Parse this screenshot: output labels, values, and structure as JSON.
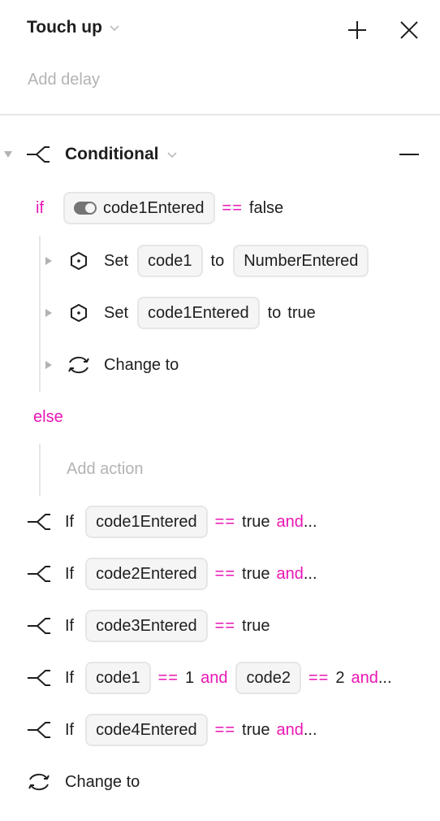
{
  "header": {
    "title": "Touch up",
    "add_delay": "Add delay"
  },
  "conditional": {
    "label": "Conditional",
    "if_keyword": "if",
    "else_keyword": "else",
    "condition": {
      "variable": "code1Entered",
      "operator": "==",
      "value": "false"
    },
    "if_actions": [
      {
        "verb": "Set",
        "target": "code1",
        "to": "to",
        "value": "NumberEntered"
      },
      {
        "verb": "Set",
        "target": "code1Entered",
        "to": "to",
        "value": "true"
      },
      {
        "label": "Change to"
      }
    ],
    "else_add_action": "Add action"
  },
  "conditions": [
    {
      "if": "If",
      "var": "code1Entered",
      "op": "==",
      "val": "true",
      "and": "and",
      "ellipsis": "..."
    },
    {
      "if": "If",
      "var": "code2Entered",
      "op": "==",
      "val": "true",
      "and": "and",
      "ellipsis": "..."
    },
    {
      "if": "If",
      "var": "code3Entered",
      "op": "==",
      "val": "true"
    },
    {
      "if": "If",
      "var": "code1",
      "op": "==",
      "val": "1",
      "and": "and",
      "var2": "code2",
      "op2": "==",
      "val2": "2",
      "and2": "and",
      "ellipsis": "..."
    },
    {
      "if": "If",
      "var": "code4Entered",
      "op": "==",
      "val": "true",
      "and": "and",
      "ellipsis": "..."
    }
  ],
  "final_action": {
    "label": "Change to"
  },
  "colors": {
    "keyword": "#e916b4",
    "muted": "#b3b3b3",
    "chip_bg": "#f5f5f5",
    "border": "#e6e6e6"
  }
}
